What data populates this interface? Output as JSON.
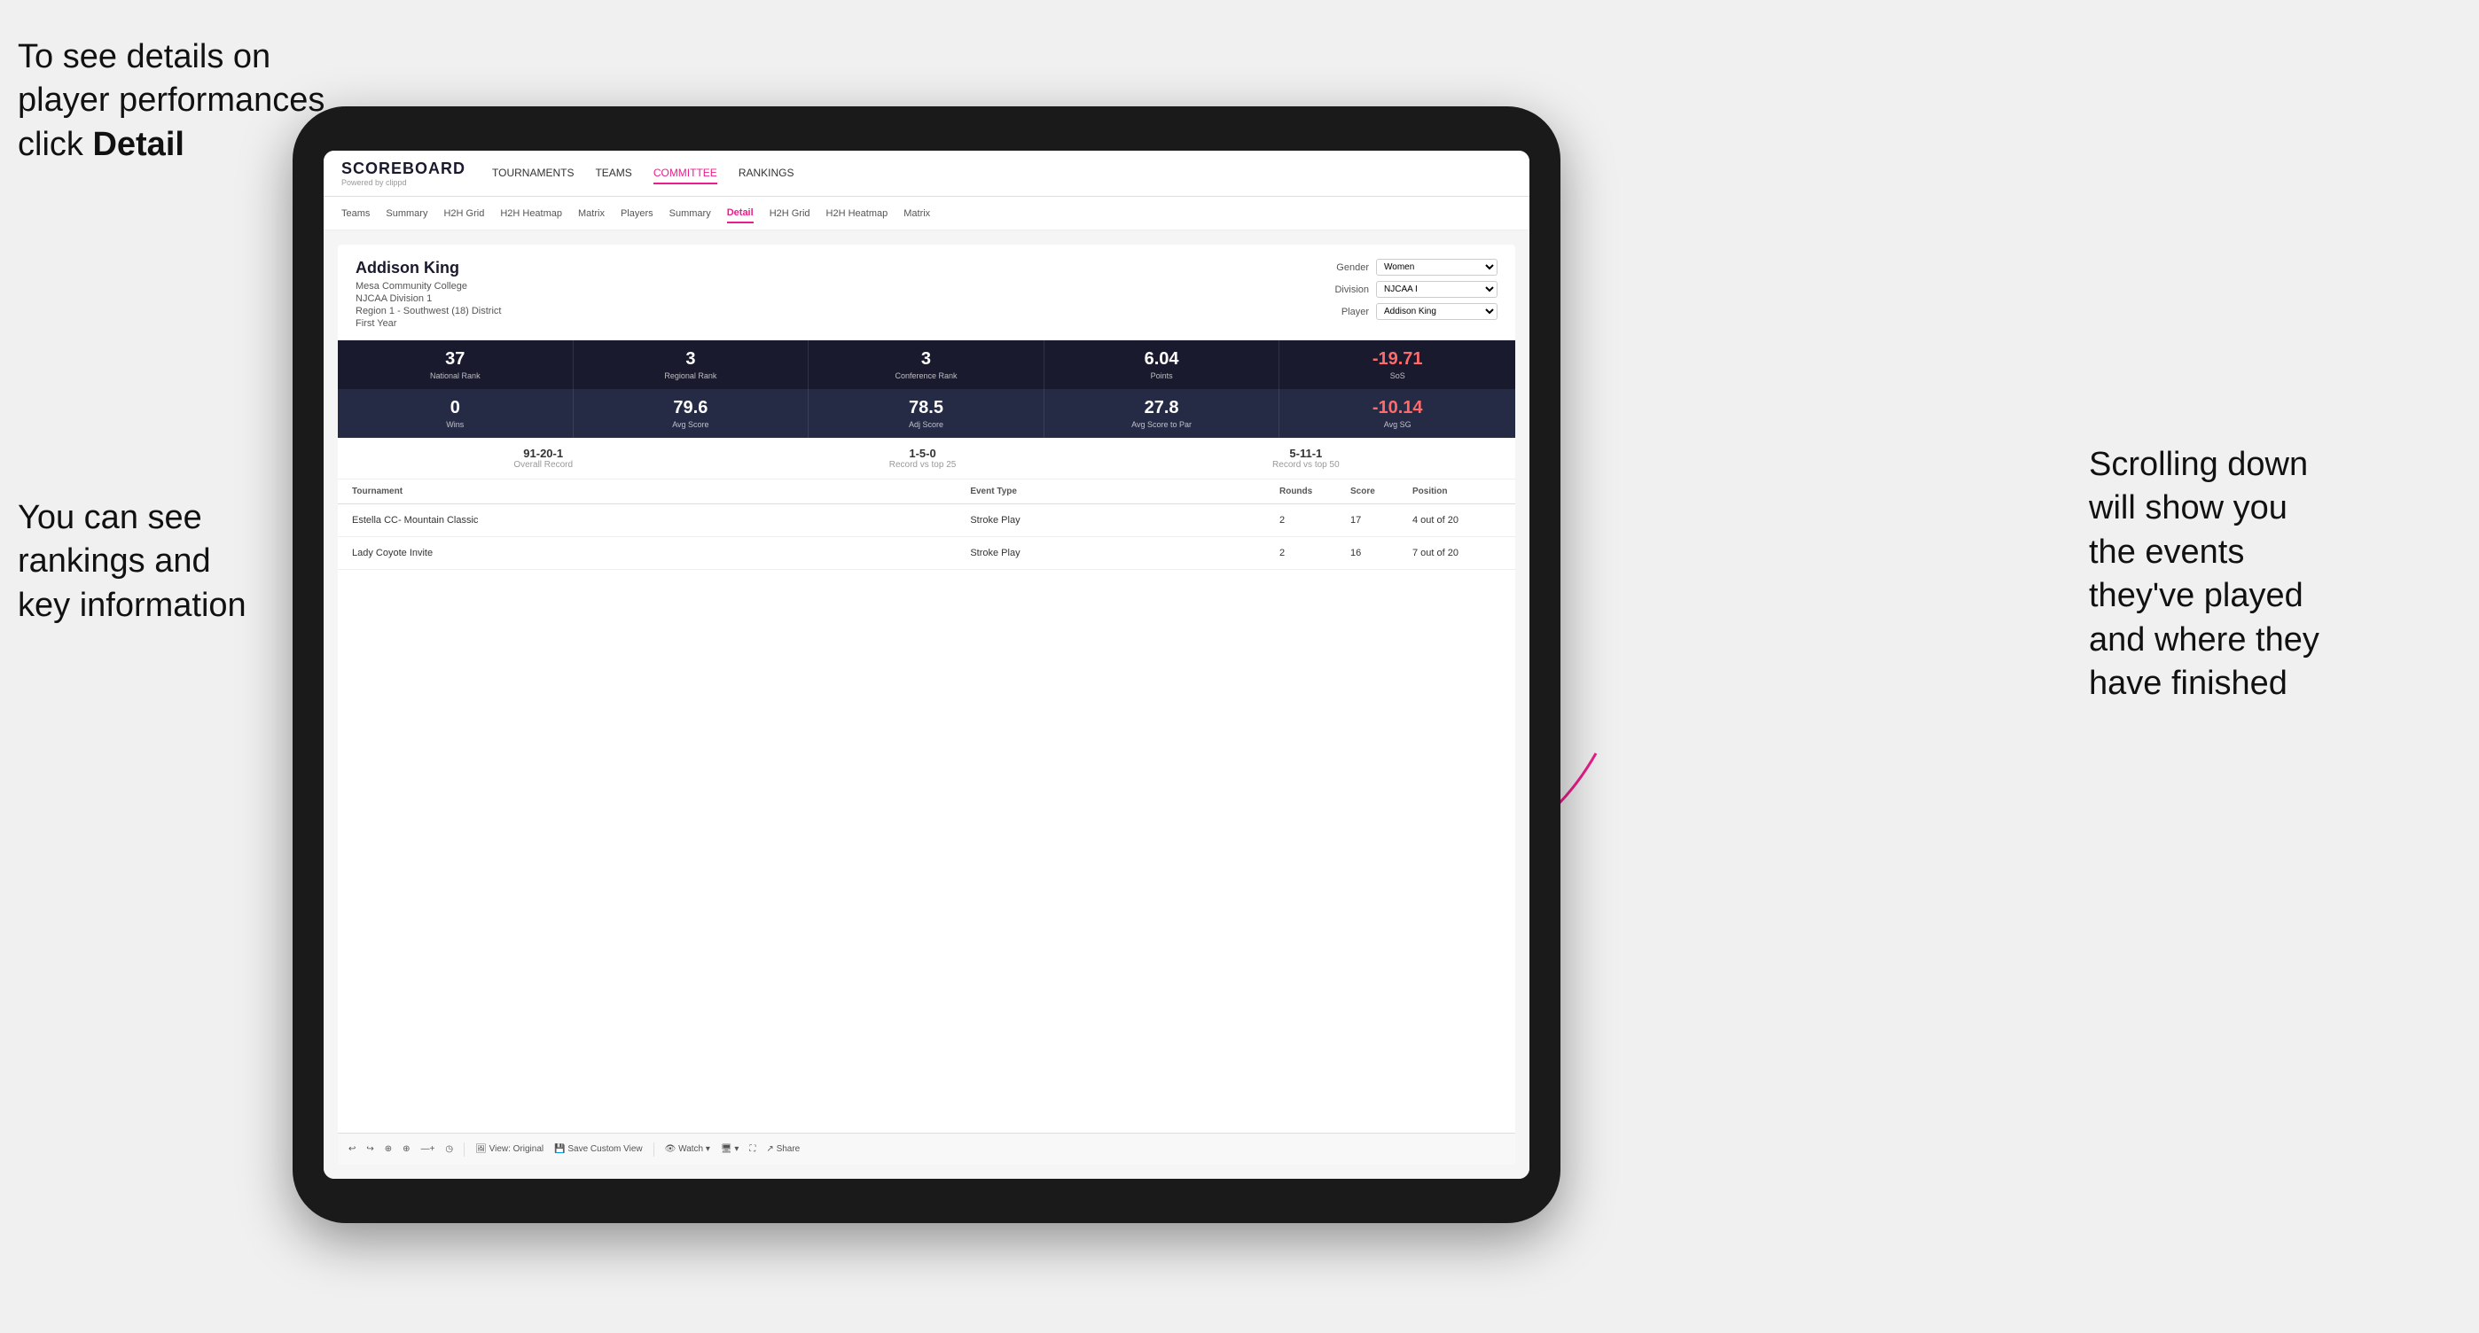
{
  "annotations": {
    "top_left": "To see details on player performances click ",
    "top_left_bold": "Detail",
    "bottom_left_line1": "You can see",
    "bottom_left_line2": "rankings and",
    "bottom_left_line3": "key information",
    "right_line1": "Scrolling down",
    "right_line2": "will show you",
    "right_line3": "the events",
    "right_line4": "they've played",
    "right_line5": "and where they",
    "right_line6": "have finished"
  },
  "nav": {
    "logo": "SCOREBOARD",
    "logo_sub": "Powered by clippd",
    "items": [
      "TOURNAMENTS",
      "TEAMS",
      "COMMITTEE",
      "RANKINGS"
    ]
  },
  "subnav": {
    "items": [
      "Teams",
      "Summary",
      "H2H Grid",
      "H2H Heatmap",
      "Matrix",
      "Players",
      "Summary",
      "Detail",
      "H2H Grid",
      "H2H Heatmap",
      "Matrix"
    ]
  },
  "player": {
    "name": "Addison King",
    "school": "Mesa Community College",
    "division": "NJCAA Division 1",
    "region": "Region 1 - Southwest (18) District",
    "year": "First Year",
    "gender_label": "Gender",
    "gender_value": "Women",
    "division_label": "Division",
    "division_value": "NJCAA I",
    "player_label": "Player",
    "player_value": "Addison King"
  },
  "stats_row1": [
    {
      "value": "37",
      "label": "National Rank"
    },
    {
      "value": "3",
      "label": "Regional Rank"
    },
    {
      "value": "3",
      "label": "Conference Rank"
    },
    {
      "value": "6.04",
      "label": "Points"
    },
    {
      "value": "-19.71",
      "label": "SoS",
      "negative": true
    }
  ],
  "stats_row2": [
    {
      "value": "0",
      "label": "Wins"
    },
    {
      "value": "79.6",
      "label": "Avg Score"
    },
    {
      "value": "78.5",
      "label": "Adj Score"
    },
    {
      "value": "27.8",
      "label": "Avg Score to Par"
    },
    {
      "value": "-10.14",
      "label": "Avg SG",
      "negative": true
    }
  ],
  "records": [
    {
      "value": "91-20-1",
      "label": "Overall Record"
    },
    {
      "value": "1-5-0",
      "label": "Record vs top 25"
    },
    {
      "value": "5-11-1",
      "label": "Record vs top 50"
    }
  ],
  "table": {
    "headers": [
      "Tournament",
      "Event Type",
      "Rounds",
      "Score",
      "Position"
    ],
    "rows": [
      {
        "tournament": "Estella CC- Mountain Classic",
        "event_type": "Stroke Play",
        "rounds": "2",
        "score": "17",
        "position": "4 out of 20"
      },
      {
        "tournament": "Lady Coyote Invite",
        "event_type": "Stroke Play",
        "rounds": "2",
        "score": "16",
        "position": "7 out of 20"
      }
    ]
  },
  "toolbar": {
    "items": [
      "↩",
      "↪",
      "⊕",
      "⊕",
      "—+",
      "◷",
      "View: Original",
      "Save Custom View",
      "Watch ▾",
      "🖥 ▾",
      "⛶",
      "Share"
    ]
  }
}
